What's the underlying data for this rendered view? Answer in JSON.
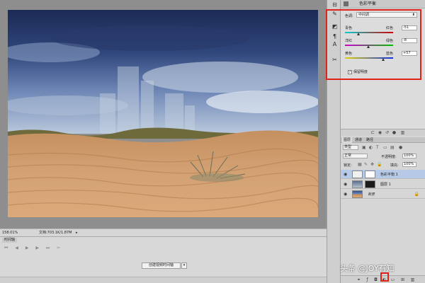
{
  "canvas": {
    "zoom": "158.01%",
    "doc": "文档:703.1K/1.87M"
  },
  "timeline": {
    "tab": "时间轴",
    "create_label": "创建视频时间轴",
    "controls": "⏮ ◀ ▶ ▶ ⏭  ✂"
  },
  "properties": {
    "title": "色彩平衡",
    "tone_label": "色调:",
    "tone_value": "中间调",
    "sliders": [
      {
        "left": "青色",
        "right": "红色",
        "value": "-51",
        "track": "cyan-red"
      },
      {
        "left": "洋红",
        "right": "绿色",
        "value": "-8",
        "track": "magenta-green"
      },
      {
        "left": "黄色",
        "right": "蓝色",
        "value": "+57",
        "track": "yellow-blue"
      }
    ],
    "preserve_luminosity": "保留明度"
  },
  "layers": {
    "tabs": [
      "图层",
      "通道",
      "路径"
    ],
    "kind": "类型",
    "blend_mode": "正常",
    "opacity_label": "不透明度:",
    "opacity": "100%",
    "lock_label": "锁定:",
    "fill_label": "填充:",
    "fill": "100%",
    "items": [
      {
        "name": "色彩平衡 1",
        "selected": true
      },
      {
        "name": "图层 1",
        "selected": false
      },
      {
        "name": "背景",
        "selected": false
      }
    ]
  },
  "watermark": "头条 @JOY有知",
  "colors": {
    "highlight": "#e2231a",
    "selection": "#b6c9e6"
  },
  "icons": {
    "eye": "eye-icon",
    "lock": "lock-icon",
    "new_layer": "new-layer-icon",
    "delete": "trash-icon"
  }
}
